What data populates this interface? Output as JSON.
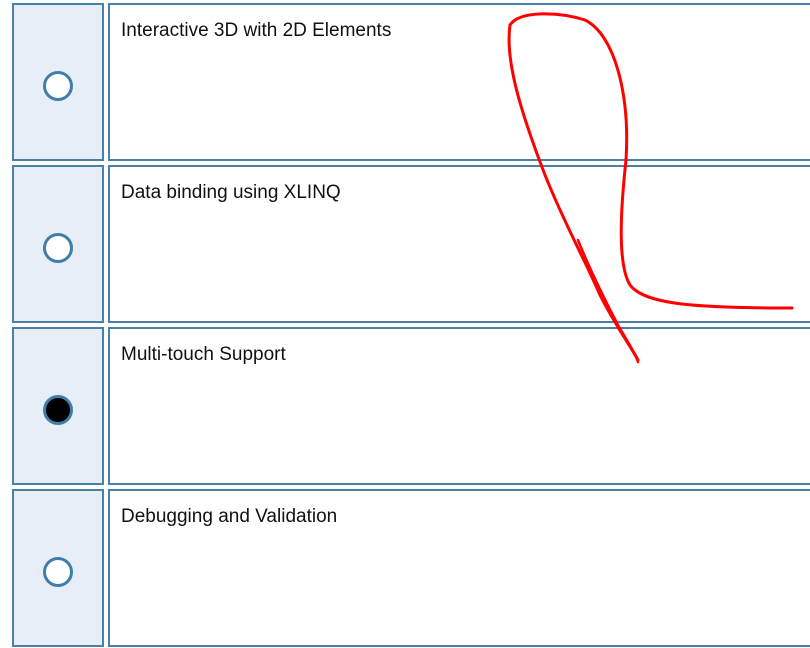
{
  "options": [
    {
      "label": "Interactive 3D with 2D Elements",
      "selected": false
    },
    {
      "label": "Data binding using XLINQ",
      "selected": false
    },
    {
      "label": "Multi-touch Support",
      "selected": true
    },
    {
      "label": "Debugging and Validation",
      "selected": false
    }
  ],
  "colors": {
    "border": "#4a7fa8",
    "radio_cell_bg": "#e8eef8",
    "radio_ring": "#3f7ea8",
    "selected_dot": "#000000",
    "annotation_stroke": "#ff0000"
  }
}
